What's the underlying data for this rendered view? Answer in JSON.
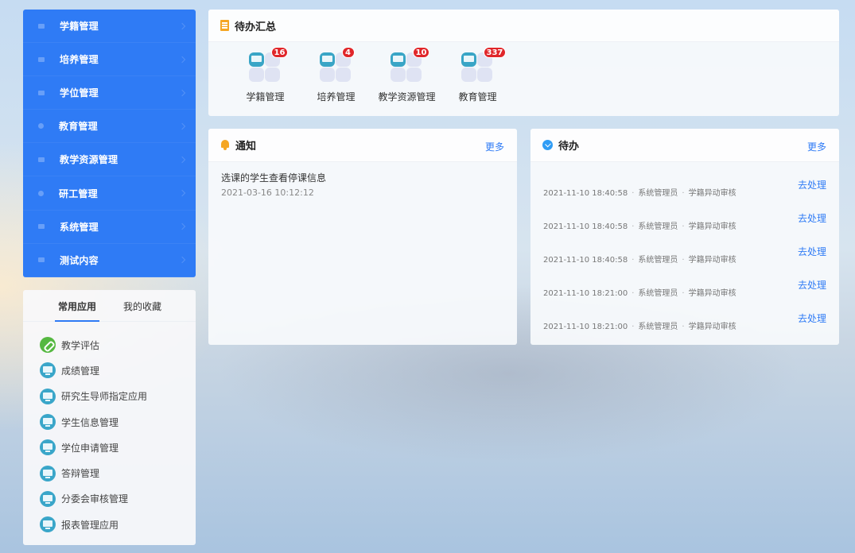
{
  "nav": {
    "items": [
      {
        "label": "学籍管理",
        "icon": "square-icon"
      },
      {
        "label": "培养管理",
        "icon": "square-icon"
      },
      {
        "label": "学位管理",
        "icon": "square-icon"
      },
      {
        "label": "教育管理",
        "icon": "circle-icon"
      },
      {
        "label": "教学资源管理",
        "icon": "square-icon"
      },
      {
        "label": "研工管理",
        "icon": "circle-icon"
      },
      {
        "label": "系统管理",
        "icon": "square-icon"
      },
      {
        "label": "测试内容",
        "icon": "square-icon"
      }
    ]
  },
  "apps": {
    "tabs": [
      {
        "label": "常用应用",
        "active": true
      },
      {
        "label": "我的收藏",
        "active": false
      }
    ],
    "items": [
      {
        "label": "教学评估",
        "icon": "link-icon"
      },
      {
        "label": "成绩管理",
        "icon": "monitor-icon"
      },
      {
        "label": "研究生导师指定应用",
        "icon": "monitor-icon"
      },
      {
        "label": "学生信息管理",
        "icon": "monitor-icon"
      },
      {
        "label": "学位申请管理",
        "icon": "monitor-icon"
      },
      {
        "label": "答辩管理",
        "icon": "monitor-icon"
      },
      {
        "label": "分委会审核管理",
        "icon": "monitor-icon"
      },
      {
        "label": "报表管理应用",
        "icon": "monitor-icon"
      }
    ]
  },
  "summary": {
    "title": "待办汇总",
    "items": [
      {
        "label": "学籍管理",
        "count": "16"
      },
      {
        "label": "培养管理",
        "count": "4"
      },
      {
        "label": "教学资源管理",
        "count": "10"
      },
      {
        "label": "教育管理",
        "count": "337"
      }
    ]
  },
  "notice": {
    "title": "通知",
    "more": "更多",
    "items": [
      {
        "title": "选课的学生查看停课信息",
        "time": "2021-03-16 10:12:12"
      }
    ]
  },
  "todo": {
    "title": "待办",
    "more": "更多",
    "action_label": "去处理",
    "separator": "·",
    "items": [
      {
        "time": "2021-11-10 18:40:58",
        "user": "系统管理员",
        "type": "学籍异动审核"
      },
      {
        "time": "2021-11-10 18:40:58",
        "user": "系统管理员",
        "type": "学籍异动审核"
      },
      {
        "time": "2021-11-10 18:40:58",
        "user": "系统管理员",
        "type": "学籍异动审核"
      },
      {
        "time": "2021-11-10 18:21:00",
        "user": "系统管理员",
        "type": "学籍异动审核"
      },
      {
        "time": "2021-11-10 18:21:00",
        "user": "系统管理员",
        "type": "学籍异动审核"
      }
    ]
  },
  "colors": {
    "primary": "#2f7bf5",
    "badge": "#e0262a",
    "accent_orange": "#f5a623"
  }
}
